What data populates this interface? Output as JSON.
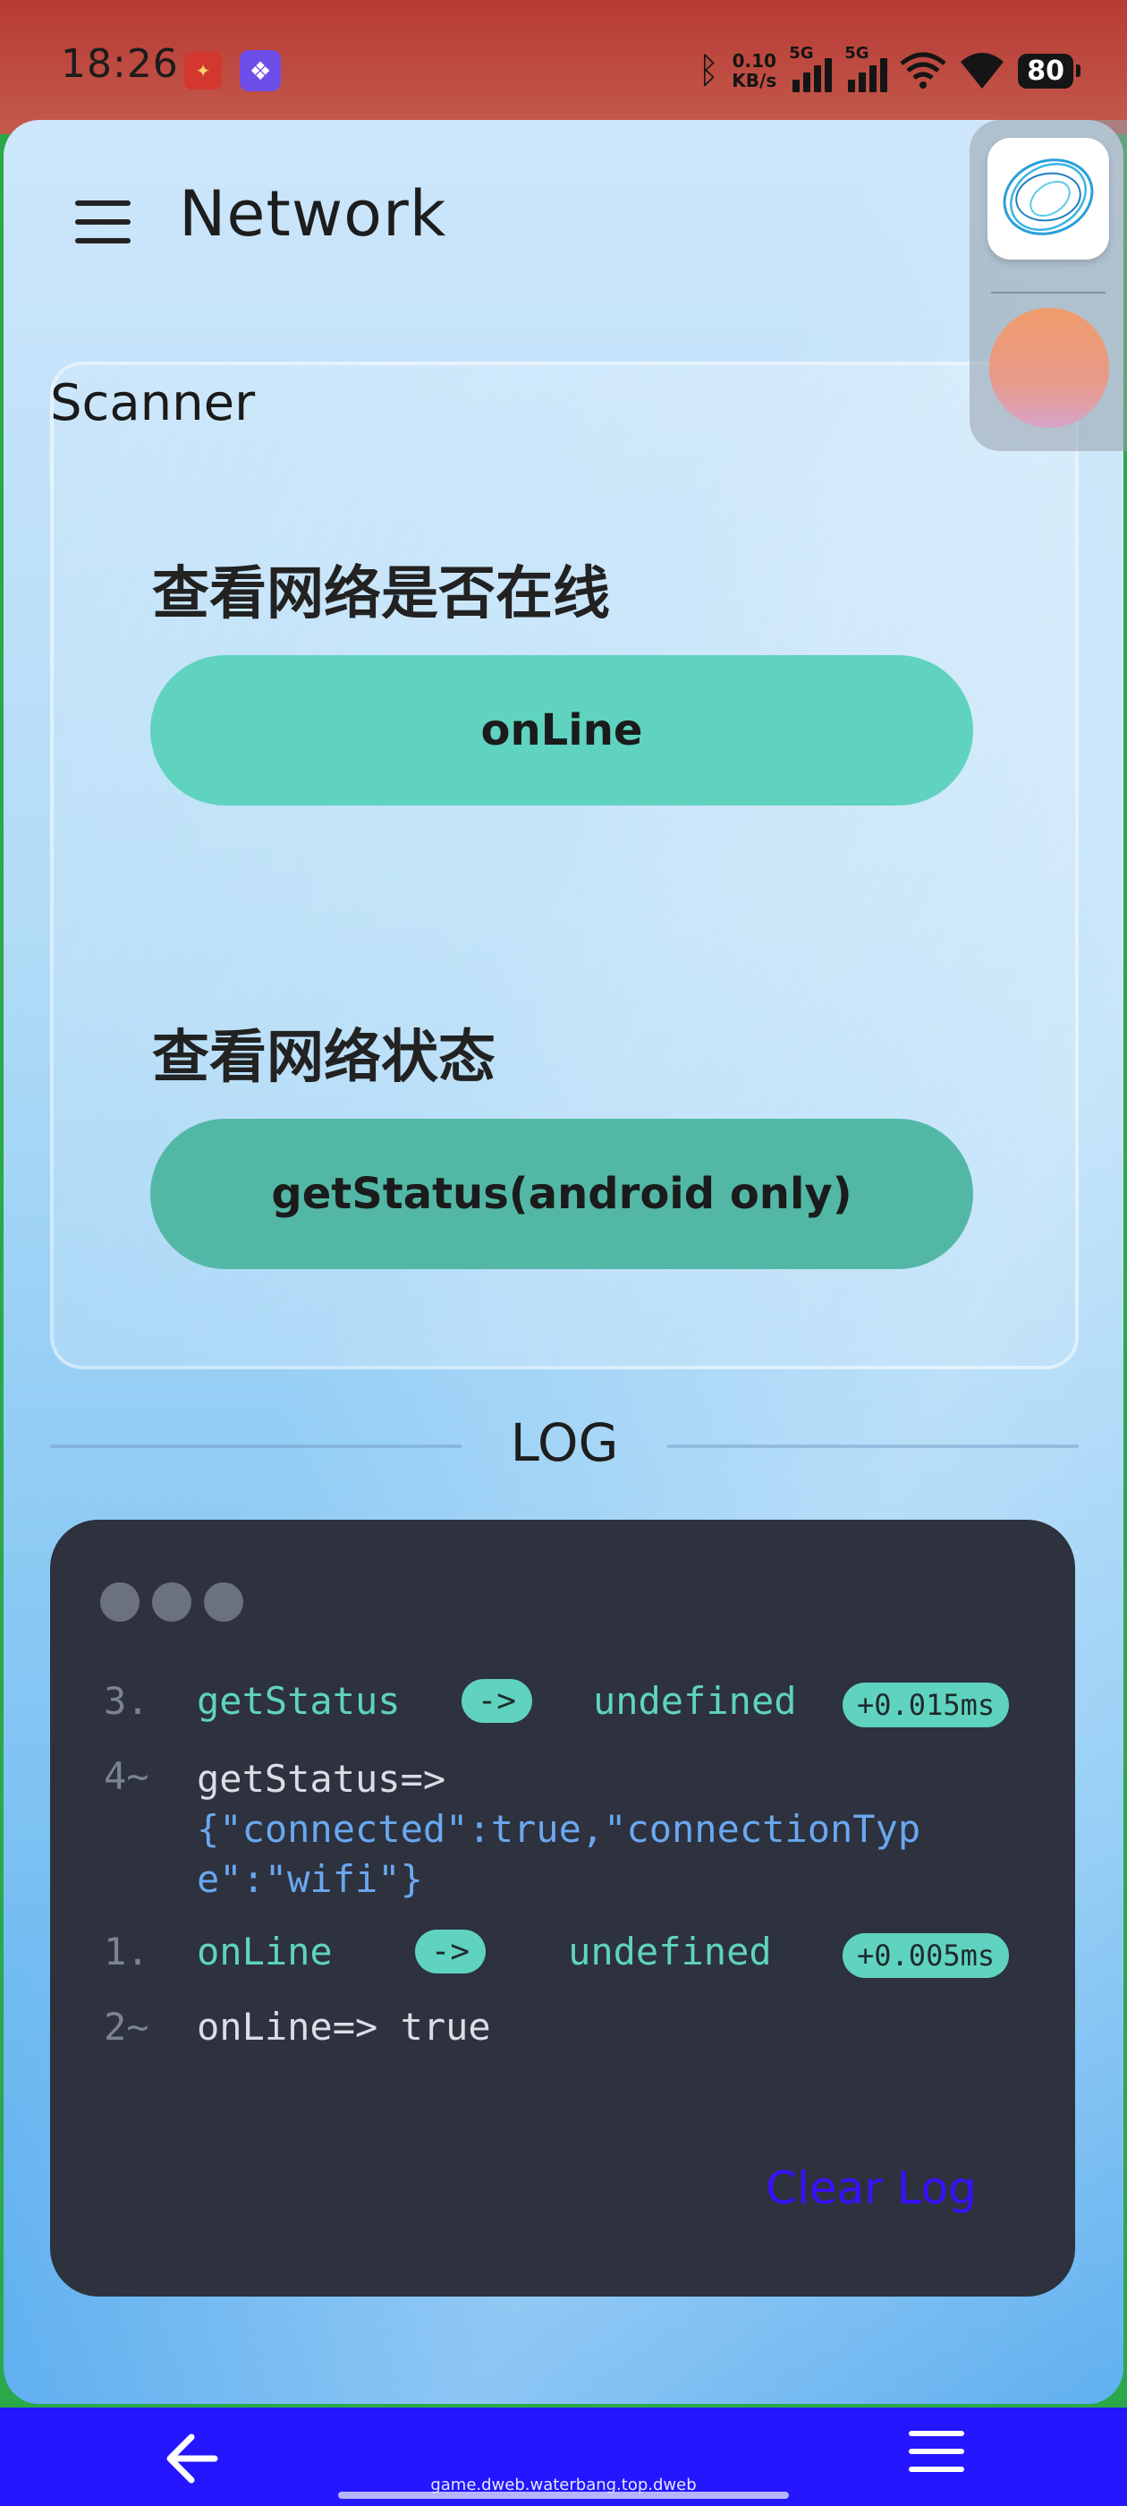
{
  "status_bar": {
    "time": "18:26",
    "speed_value": "0.10",
    "speed_unit": "KB/s",
    "signal_1_label": "5G",
    "signal_2_label": "5G",
    "battery": "80"
  },
  "app": {
    "title": "Network"
  },
  "scanner": {
    "label": "Scanner",
    "online_section_title": "查看网络是否在线",
    "online_button": "onLine",
    "status_section_title": "查看网络状态",
    "status_button": "getStatus(android only)"
  },
  "log": {
    "heading": "LOG",
    "entries": [
      {
        "num": "3.",
        "fn": "getStatus",
        "arrow": "->",
        "result": "undefined",
        "time": "+0.015ms"
      },
      {
        "num": "4~",
        "text": "getStatus=>",
        "json_line1": "{\"connected\":true,\"connectionTyp",
        "json_line2": "e\":\"wifi\"}"
      },
      {
        "num": "1.",
        "fn": "onLine",
        "arrow": "->",
        "result": "undefined",
        "time": "+0.005ms"
      },
      {
        "num": "2~",
        "text": "onLine=> true"
      }
    ],
    "clear_label": "Clear Log"
  },
  "navigation": {
    "url": "game.dweb.waterbang.top.dweb"
  },
  "colors": {
    "accent": "#5fd3bf",
    "accent_dark": "#52b8a5",
    "terminal_bg": "#2d323e",
    "clear_log": "#3a10ff",
    "nav_bg": "#2416ff"
  }
}
